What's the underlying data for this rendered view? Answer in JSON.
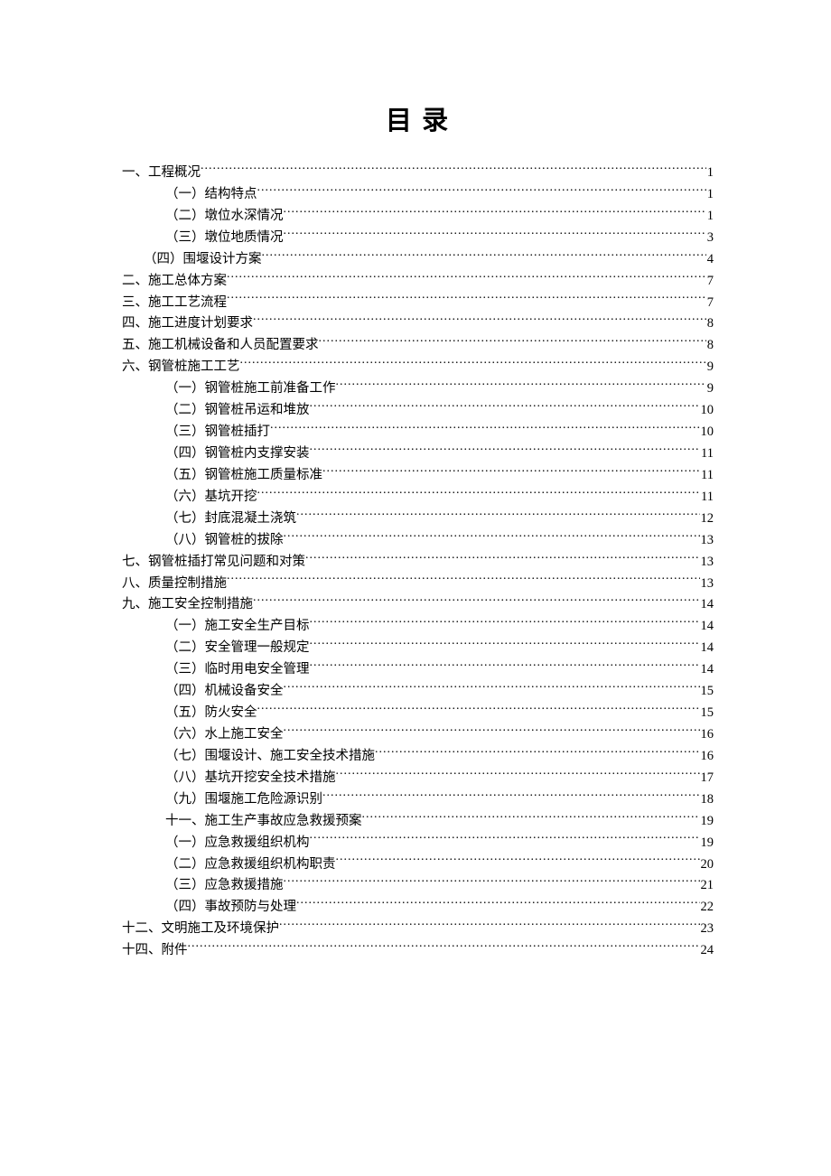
{
  "title": "目 录",
  "entries": [
    {
      "level": 1,
      "indent": 0,
      "label": "一、工程概况",
      "page": "1"
    },
    {
      "level": 2,
      "indent": 0,
      "label": "（一）结构特点",
      "page": "1"
    },
    {
      "level": 2,
      "indent": 0,
      "label": "（二）墩位水深情况",
      "page": "1"
    },
    {
      "level": 2,
      "indent": 0,
      "label": "（三）墩位地质情况",
      "page": "3"
    },
    {
      "level": 1,
      "indent": 1,
      "label": "（四）围堰设计方案",
      "page": "4"
    },
    {
      "level": 1,
      "indent": 0,
      "label": "二、施工总体方案",
      "page": "7"
    },
    {
      "level": 1,
      "indent": 0,
      "label": "三、施工工艺流程",
      "page": "7"
    },
    {
      "level": 1,
      "indent": 0,
      "label": "四、施工进度计划要求",
      "page": "8"
    },
    {
      "level": 1,
      "indent": 0,
      "label": "五、施工机械设备和人员配置要求",
      "page": "8"
    },
    {
      "level": 1,
      "indent": 0,
      "label": "六、钢管桩施工工艺",
      "page": "9"
    },
    {
      "level": 2,
      "indent": 0,
      "label": "（一）钢管桩施工前准备工作",
      "page": "9"
    },
    {
      "level": 2,
      "indent": 0,
      "label": "（二）钢管桩吊运和堆放",
      "page": "10"
    },
    {
      "level": 2,
      "indent": 0,
      "label": "（三）钢管桩插打",
      "page": "10"
    },
    {
      "level": 2,
      "indent": 0,
      "label": "（四）钢管桩内支撑安装",
      "page": "11"
    },
    {
      "level": 2,
      "indent": 0,
      "label": "（五）钢管桩施工质量标准",
      "page": "11"
    },
    {
      "level": 2,
      "indent": 0,
      "label": "（六）基坑开挖",
      "page": "11"
    },
    {
      "level": 2,
      "indent": 0,
      "label": "（七）封底混凝土浇筑",
      "page": "12"
    },
    {
      "level": 2,
      "indent": 0,
      "label": "（八）钢管桩的拔除",
      "page": "13"
    },
    {
      "level": 1,
      "indent": 0,
      "label": "七、钢管桩插打常见问题和对策",
      "page": "13"
    },
    {
      "level": 1,
      "indent": 0,
      "label": "八、质量控制措施",
      "page": "13"
    },
    {
      "level": 1,
      "indent": 0,
      "label": "九、施工安全控制措施",
      "page": "14"
    },
    {
      "level": 2,
      "indent": 0,
      "label": "（一）施工安全生产目标",
      "page": "14"
    },
    {
      "level": 2,
      "indent": 0,
      "label": "（二）安全管理一般规定",
      "page": "14"
    },
    {
      "level": 2,
      "indent": 0,
      "label": "（三）临时用电安全管理",
      "page": "14"
    },
    {
      "level": 2,
      "indent": 0,
      "label": "（四）机械设备安全",
      "page": "15"
    },
    {
      "level": 2,
      "indent": 0,
      "label": "（五）防火安全",
      "page": "15"
    },
    {
      "level": 2,
      "indent": 0,
      "label": "（六）水上施工安全",
      "page": "16"
    },
    {
      "level": 2,
      "indent": 0,
      "label": "（七）围堰设计、施工安全技术措施",
      "page": "16"
    },
    {
      "level": 2,
      "indent": 0,
      "label": "（八）基坑开挖安全技术措施",
      "page": "17"
    },
    {
      "level": 2,
      "indent": 0,
      "label": "（九）围堰施工危险源识别",
      "page": "18"
    },
    {
      "level": 2,
      "indent": 0,
      "label": "十一、施工生产事故应急救援预案",
      "page": "19"
    },
    {
      "level": 2,
      "indent": 0,
      "label": "（一）应急救援组织机构",
      "page": "19"
    },
    {
      "level": 2,
      "indent": 0,
      "label": "（二）应急救援组织机构职责",
      "page": "20"
    },
    {
      "level": 2,
      "indent": 0,
      "label": "（三）应急救援措施",
      "page": "21"
    },
    {
      "level": 2,
      "indent": 0,
      "label": "（四）事故预防与处理",
      "page": "22"
    },
    {
      "level": 1,
      "indent": 0,
      "label": "十二、文明施工及环境保护",
      "page": "23"
    },
    {
      "level": 1,
      "indent": 0,
      "label": "十四、附件",
      "page": "24"
    }
  ]
}
